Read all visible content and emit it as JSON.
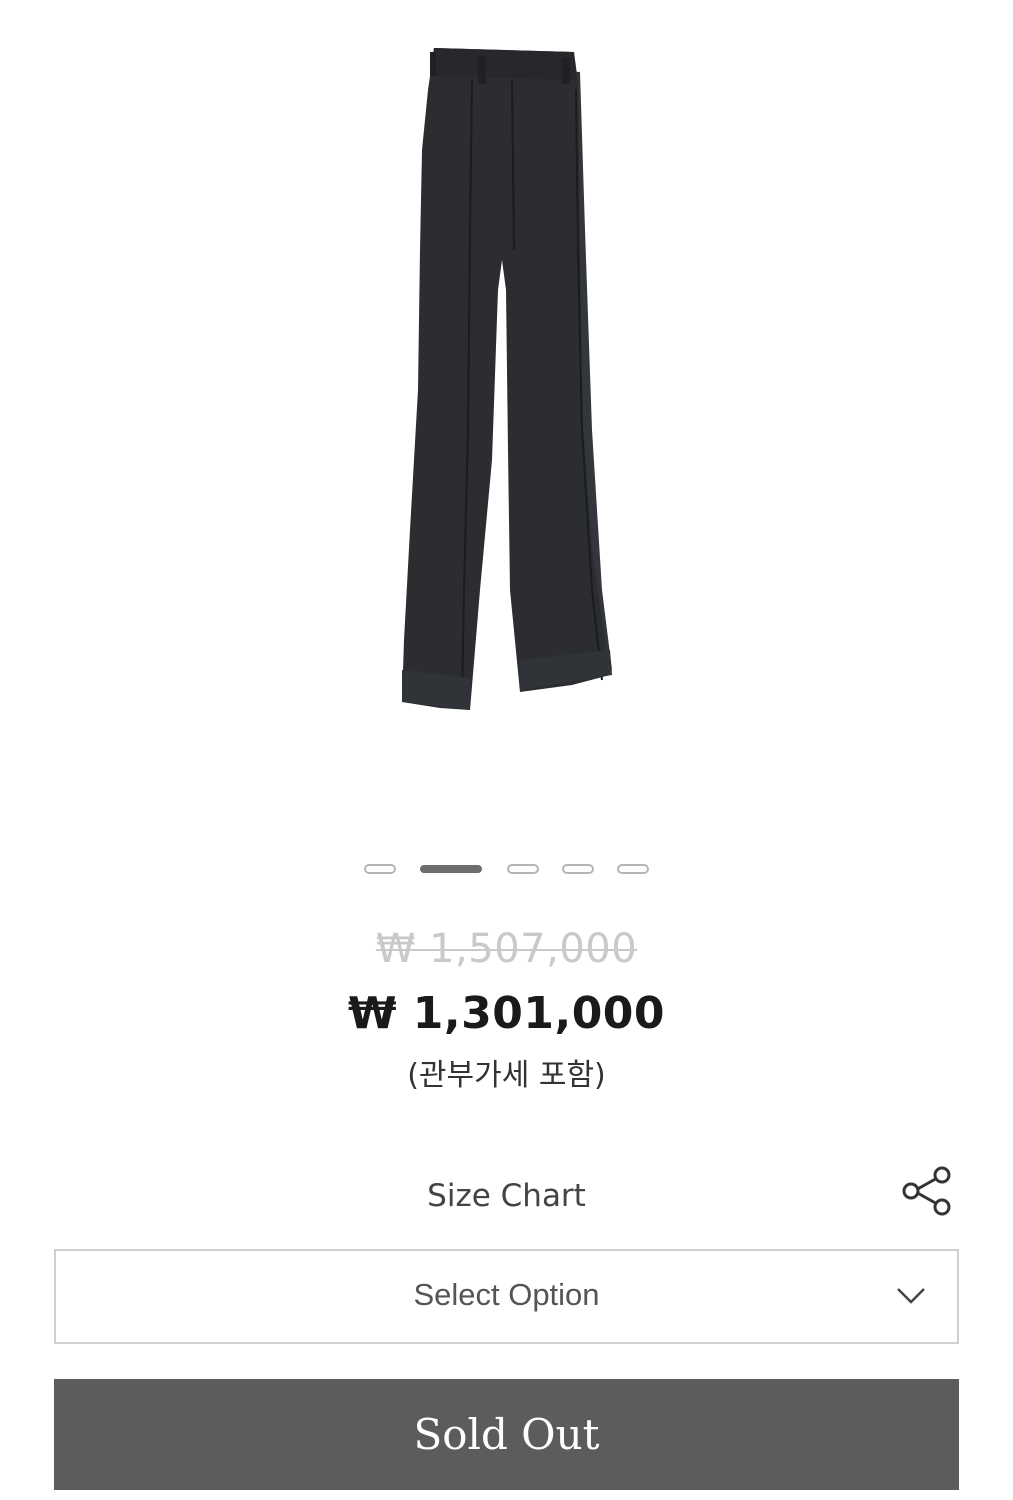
{
  "product": {
    "image_icon": "black-flared-trousers-image"
  },
  "carousel": {
    "total_slides": 5,
    "active_index": 1
  },
  "pricing": {
    "original_price": "₩ 1,507,000",
    "sale_price": "₩ 1,301,000",
    "tax_note": "(관부가세 포함)"
  },
  "actions": {
    "size_chart_label": "Size Chart",
    "share_icon": "share-icon",
    "select_option_label": "Select Option",
    "select_chevron_icon": "chevron-down-icon",
    "sold_out_label": "Sold Out"
  },
  "colors": {
    "garment": "#2b2d31",
    "sold_out_bg": "#5c5c5c",
    "price_strike": "#c9c9c9",
    "dot_active": "#6e6e6e",
    "dot_inactive": "#b5b5b5"
  }
}
